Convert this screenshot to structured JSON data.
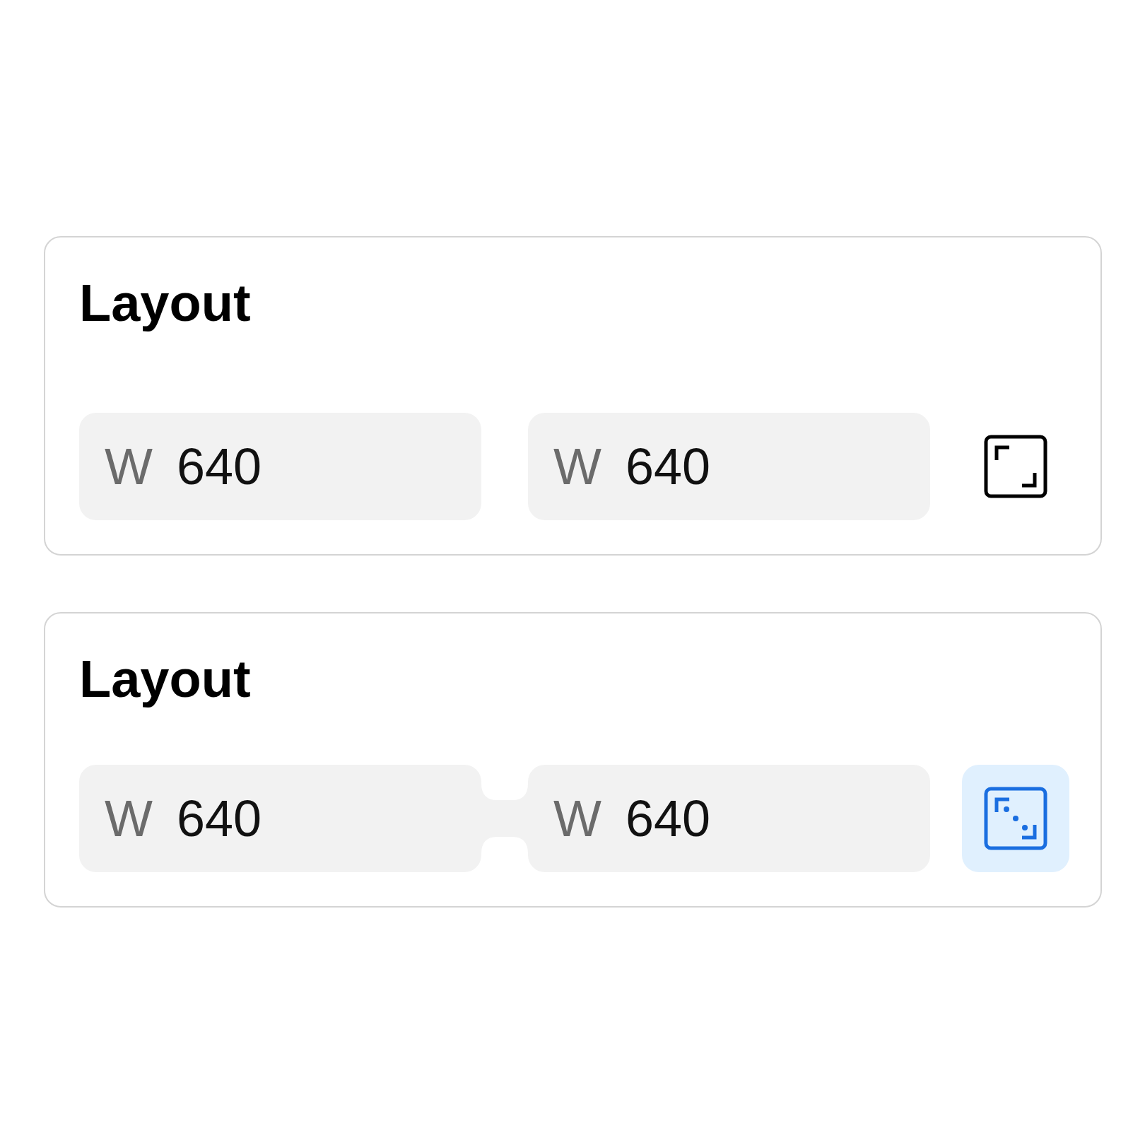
{
  "cards": [
    {
      "title": "Layout",
      "linked": false,
      "fields": [
        {
          "label": "W",
          "value": "640"
        },
        {
          "label": "W",
          "value": "640"
        }
      ]
    },
    {
      "title": "Layout",
      "linked": true,
      "fields": [
        {
          "label": "W",
          "value": "640"
        },
        {
          "label": "W",
          "value": "640"
        }
      ]
    }
  ]
}
